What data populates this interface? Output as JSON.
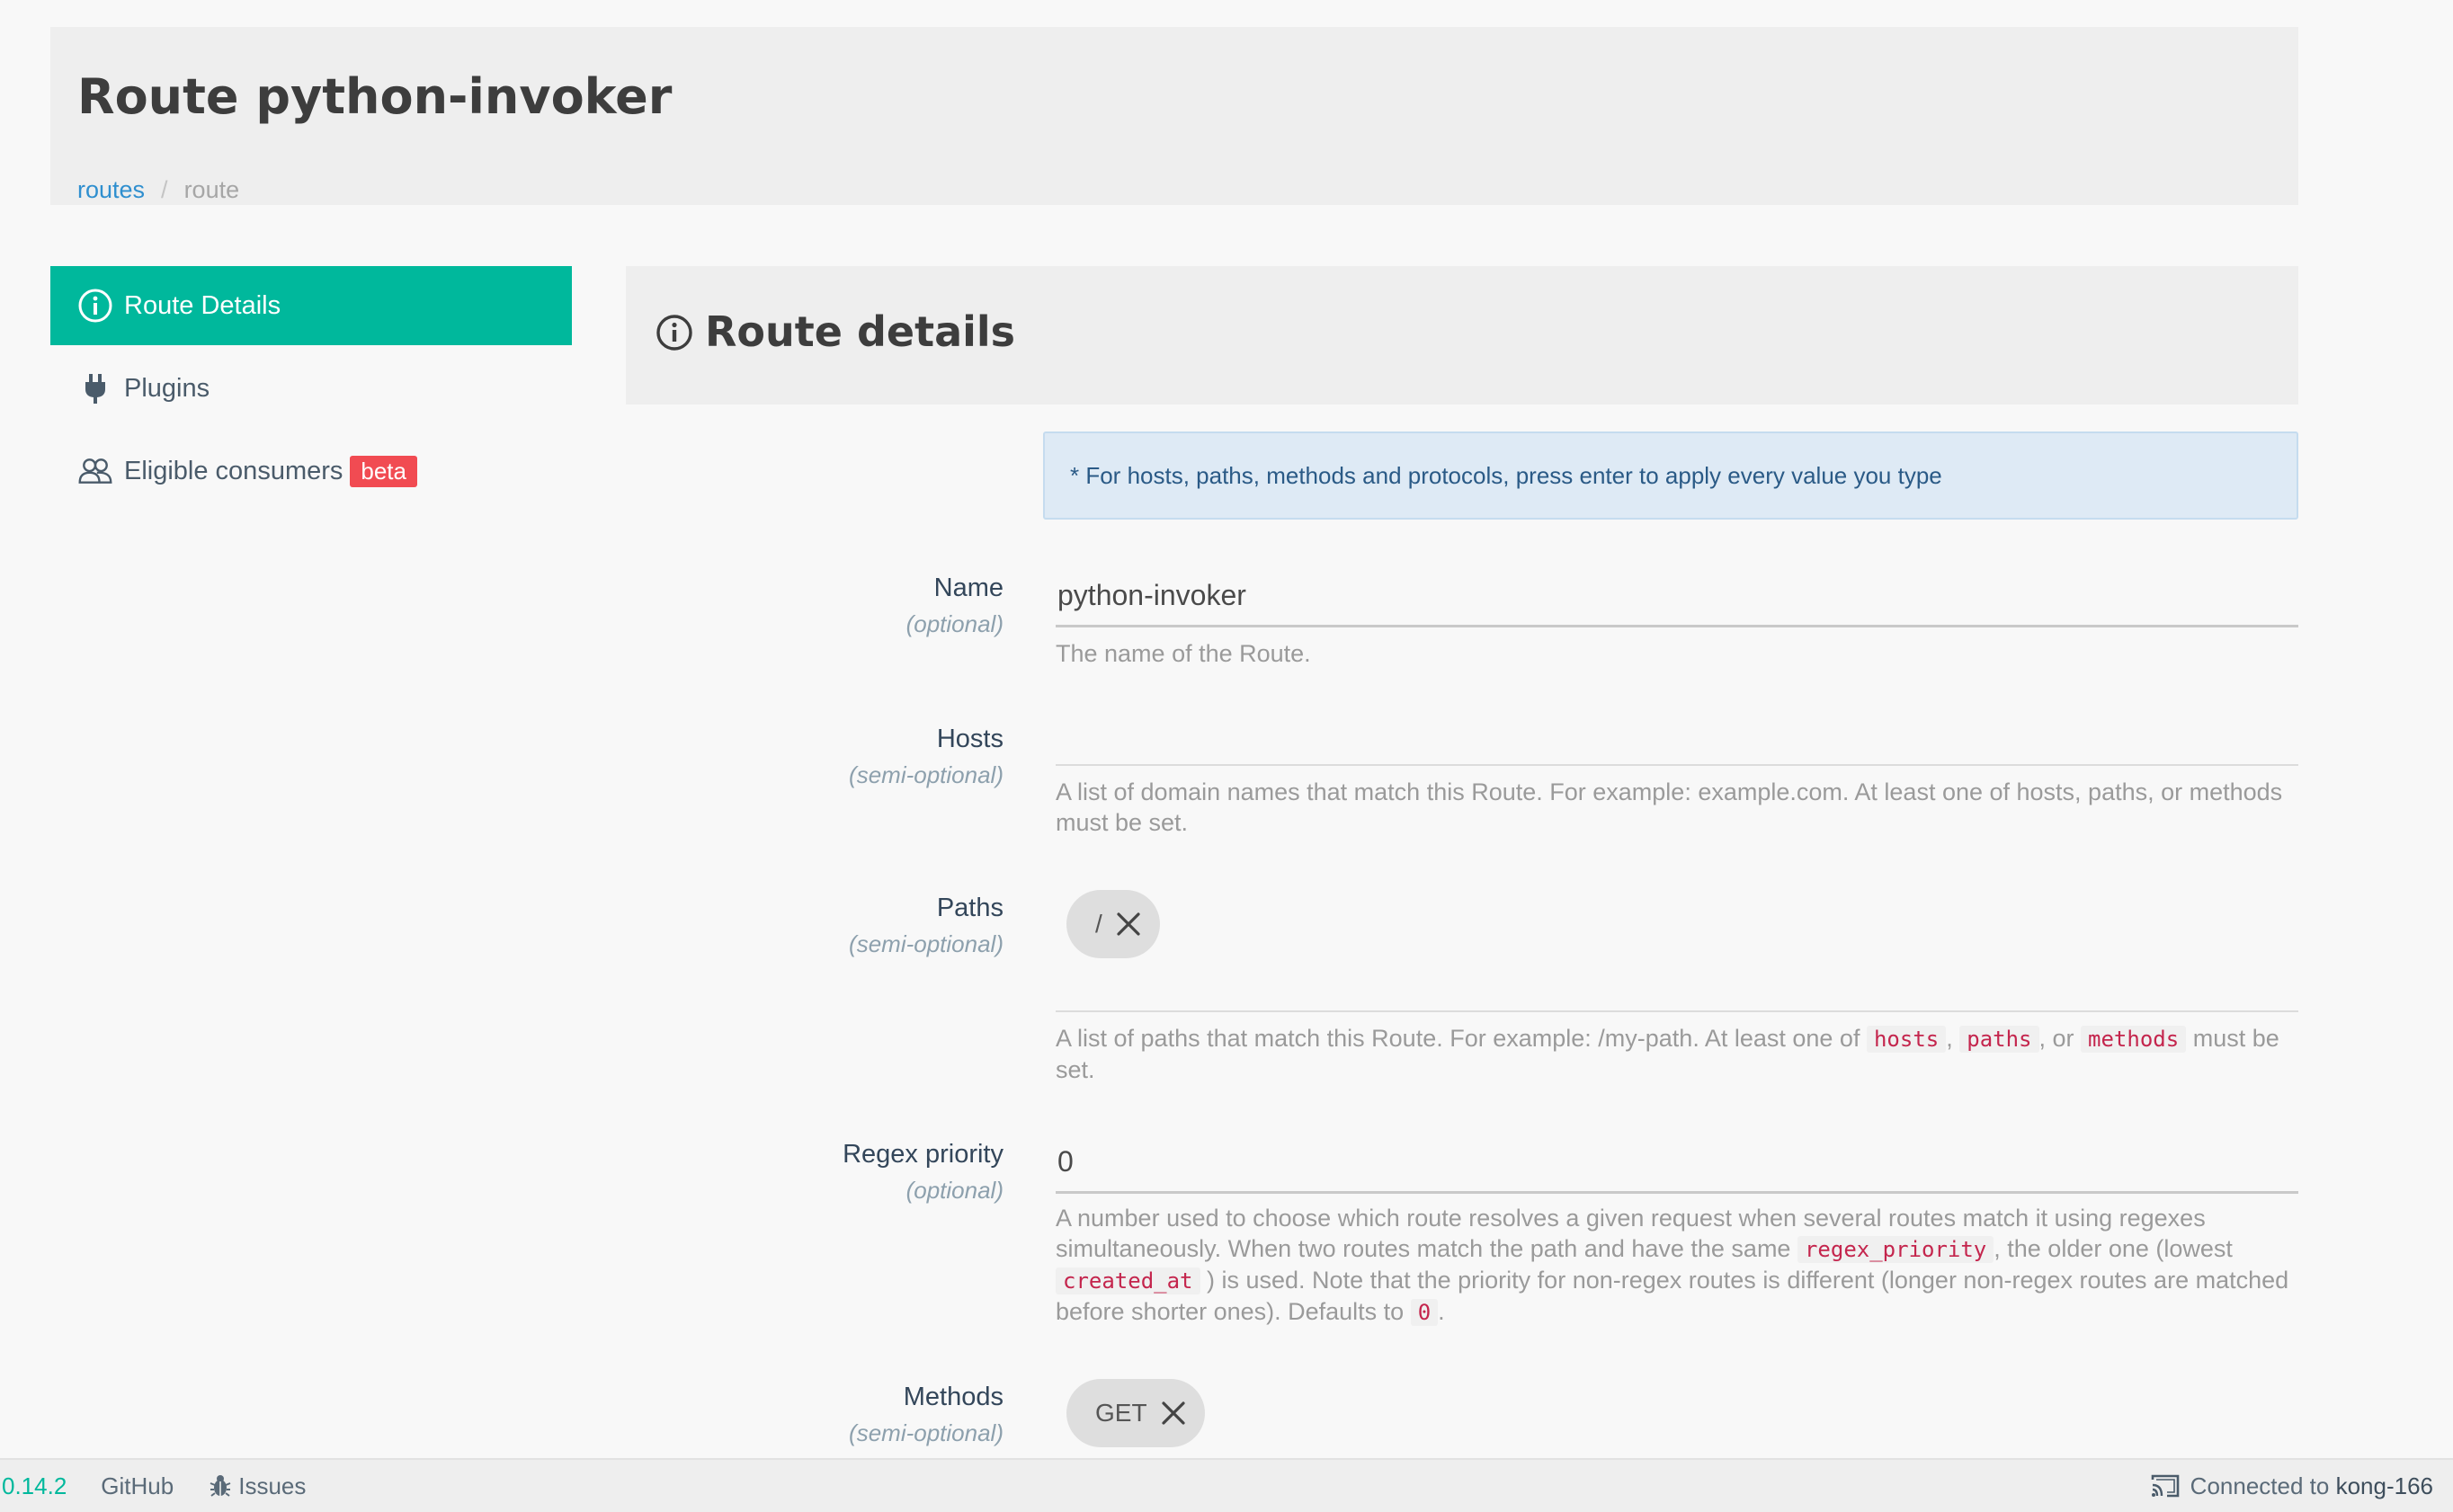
{
  "header": {
    "title": "Route python-invoker",
    "breadcrumb": {
      "parent": "routes",
      "separator": "/",
      "current": "route"
    }
  },
  "sidebar": {
    "items": [
      {
        "label": "Route Details",
        "icon": "info-circle-icon",
        "active": true
      },
      {
        "label": "Plugins",
        "icon": "plug-icon",
        "active": false
      },
      {
        "label": "Eligible consumers",
        "icon": "users-icon",
        "active": false,
        "badge": "beta"
      }
    ]
  },
  "panel": {
    "title": "Route details",
    "notice": "* For hosts, paths, methods and protocols, press enter to apply every value you type"
  },
  "form": {
    "name": {
      "label": "Name",
      "qualifier": "(optional)",
      "value": "python-invoker",
      "help": "The name of the Route."
    },
    "hosts": {
      "label": "Hosts",
      "qualifier": "(semi-optional)",
      "value": "",
      "help": "A list of domain names that match this Route. For example: example.com. At least one of hosts, paths, or methods must be set."
    },
    "paths": {
      "label": "Paths",
      "qualifier": "(semi-optional)",
      "chips": [
        "/"
      ],
      "help_a": "A list of paths that match this Route. For example: /my-path. At least one of",
      "code_1": "hosts",
      "sep_1": ",",
      "code_2": "paths",
      "sep_2": ", or",
      "code_3": "methods",
      "help_b": "must be set."
    },
    "regex_priority": {
      "label": "Regex priority",
      "qualifier": "(optional)",
      "value": "0",
      "help_a": "A number used to choose which route resolves a given request when several routes match it using regexes simultaneously. When two routes match the path and have the same",
      "code_1": "regex_priority",
      "help_b": ", the older one (lowest",
      "code_2": "created_at",
      "help_c": ") is used. Note that the priority for non-regex routes is different (longer non-regex routes are matched before shorter ones). Defaults to",
      "code_3": "0",
      "help_d": "."
    },
    "methods": {
      "label": "Methods",
      "qualifier": "(semi-optional)",
      "chips": [
        "GET"
      ]
    }
  },
  "footer": {
    "version": "0.14.2",
    "github": "GitHub",
    "issues": "Issues",
    "connected_prefix": "Connected to",
    "connected_host": "kong-166"
  },
  "colors": {
    "accent": "#00b89c",
    "link": "#2f8fcf",
    "badge": "#f14b52",
    "code": "#c4254d"
  }
}
